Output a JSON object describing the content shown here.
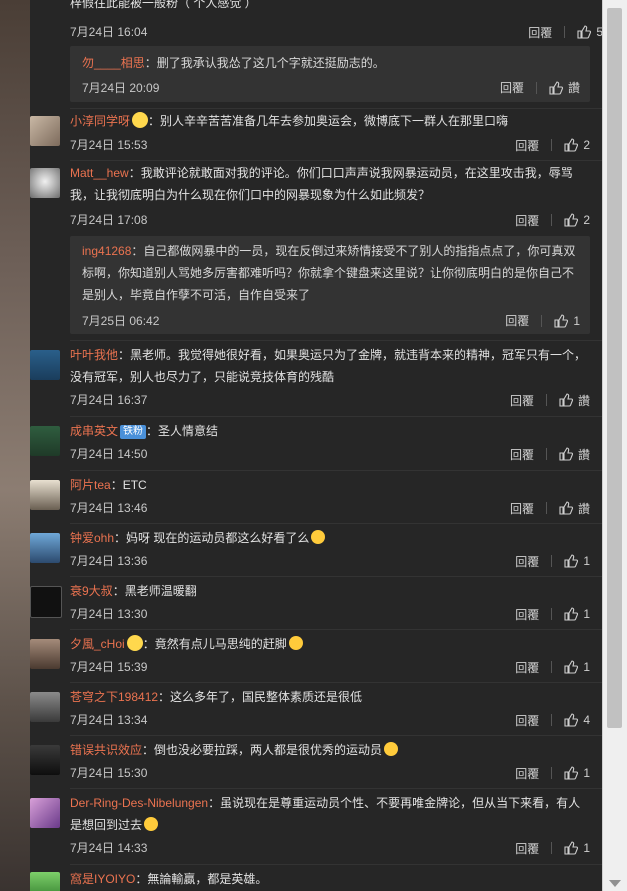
{
  "actions": {
    "reply": "回覆",
    "like_label": "讚"
  },
  "top_partial": {
    "text": "梓假往此能被一般粉（ 个人感觉 ）"
  },
  "comments": [
    {
      "id": "c0",
      "user": "",
      "text": "",
      "time": "7月24日 16:04",
      "likes": "5"
    },
    {
      "id": "r0",
      "user": "勿____相思",
      "text": "：删了我承认我怂了这几个字就还挺励志的。",
      "time": "7月24日 20:09",
      "likes": "讚"
    },
    {
      "id": "c1",
      "user": "小淳同学呀",
      "text": "：别人辛辛苦苦准备几年去参加奥运会，微博底下一群人在那里口嗨",
      "time": "7月24日 15:53",
      "likes": "2"
    },
    {
      "id": "c2",
      "user": "Matt__hew",
      "text": "：我敢评论就敢面对我的评论。你们口口声声说我网暴运动员，在这里攻击我，辱骂我，让我彻底明白为什么现在你们口中的网暴现象为什么如此频发？",
      "time": "7月24日 17:08",
      "likes": "2"
    },
    {
      "id": "r2",
      "user": "ing41268",
      "text": "：自己都做网暴中的一员，现在反倒过来矫情接受不了别人的指指点点了，你可真双标啊，你知道别人骂她多厉害都难听吗？你就拿个键盘来这里说？让你彻底明白的是你自己不是别人，毕竟自作孽不可活，自作自受来了",
      "time": "7月25日 06:42",
      "likes": "1"
    },
    {
      "id": "c3",
      "user": "叶叶我他",
      "text": "：黑老师。我觉得她很好看，如果奥运只为了金牌，就违背本来的精神，冠军只有一个，没有冠军，别人也尽力了，只能说竞技体育的残酷",
      "time": "7月24日 16:37",
      "likes": "讚"
    },
    {
      "id": "c4",
      "user": "成串英文",
      "badge": "铁粉",
      "text": "：圣人情意结",
      "time": "7月24日 14:50",
      "likes": "讚"
    },
    {
      "id": "c5",
      "user": "阿片tea",
      "text": "：ETC",
      "time": "7月24日 13:46",
      "likes": "讚"
    },
    {
      "id": "c6",
      "user": "钟爱ohh",
      "text": "：妈呀  现在的运动员都这么好看了么",
      "time": "7月24日 13:36",
      "likes": "1"
    },
    {
      "id": "c7",
      "user": "衰9大叔",
      "text": "：黑老师温暖翻",
      "time": "7月24日 13:30",
      "likes": "1"
    },
    {
      "id": "c8",
      "user": "夕風_cHoi",
      "text": "：竟然有点儿马思纯的赶脚",
      "time": "7月24日 15:39",
      "likes": "1"
    },
    {
      "id": "c9",
      "user": "苍穹之下198412",
      "text": "：这么多年了，国民整体素质还是很低",
      "time": "7月24日 13:34",
      "likes": "4"
    },
    {
      "id": "c10",
      "user": "错误共识效应",
      "text": "：倒也没必要拉踩，两人都是很优秀的运动员",
      "time": "7月24日 15:30",
      "likes": "1"
    },
    {
      "id": "c11",
      "user": "Der-Ring-Des-Nibelungen",
      "text": "：虽说现在是尊重运动员个性、不要再唯金牌论，但从当下来看，有人是想回到过去",
      "time": "7月24日 14:33",
      "likes": "1"
    },
    {
      "id": "c12",
      "user": "窩是IYOIYO",
      "text": "：無論輸贏，都是英雄。",
      "time": "",
      "likes": ""
    }
  ],
  "colors": {
    "username": "#eb7350",
    "text": "#e2e2e2",
    "panel": "#262626",
    "reply_box": "#333333"
  }
}
